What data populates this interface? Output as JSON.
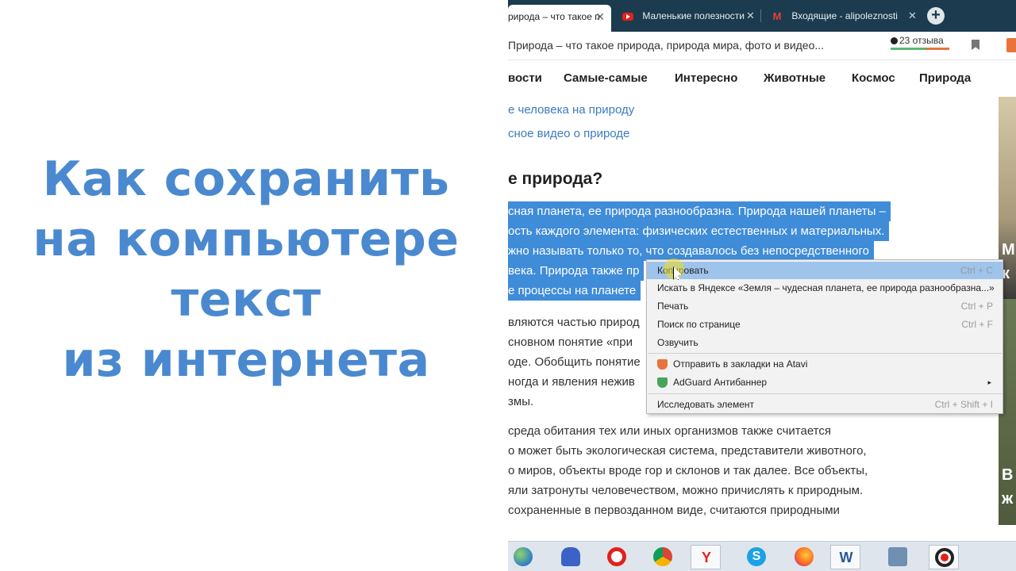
{
  "title": {
    "lines": [
      "Как сохранить",
      "на компьютере",
      "текст",
      "из интернета"
    ]
  },
  "tabs": [
    {
      "label": "рирода – что такое п",
      "close": "✕",
      "active": true
    },
    {
      "label": "Маленькие полезности",
      "close": "✕",
      "active": false
    },
    {
      "label": "Входящие - alipoleznosti",
      "close": "✕",
      "active": false
    }
  ],
  "newtab_symbol": "+",
  "addressbar": {
    "page_title": "Природа – что такое природа, природа мира, фото и видео...",
    "reviews": "23 отзыва"
  },
  "site_nav": [
    "вости",
    "Самые-самые",
    "Интересно",
    "Животные",
    "Космос",
    "Природа"
  ],
  "content": {
    "links": [
      "е человека на природу",
      "сное видео о природе"
    ],
    "section_heading": "е природа?",
    "selected_lines": [
      "сная планета, ее природа разнообразна. Природа нашей планеты –",
      "ость каждого элемента: физических естественных и материальных.",
      "жно называть только то, что создавалось без непосредственного",
      "века. Природа также пр",
      "е процессы на планете"
    ],
    "body_lines_a": [
      "вляются частью природ",
      "сновном понятие «при",
      "оде. Обобщить понятие",
      "ногда и явления нежив",
      "змы."
    ],
    "body_lines_b": [
      "среда обитания тех или иных организмов также считается",
      "о может быть экологическая система, представители животного,",
      "о миров, объекты вроде гор и склонов и так далее. Все объекты,",
      "яли затронуты человечеством, можно причислять к природным.",
      "сохраненные в первозданном виде, считаются природными"
    ]
  },
  "right_column_letters": [
    "М",
    "к",
    "В",
    "ж"
  ],
  "context_menu": {
    "items": [
      {
        "label": "Копировать",
        "shortcut": "Ctrl + C",
        "highlighted": true
      },
      {
        "label": "Искать в Яндексе «Земля – чудесная планета, ее природа разнообразна...»",
        "shortcut": ""
      },
      {
        "label": "Печать",
        "shortcut": "Ctrl + P"
      },
      {
        "label": "Поиск по странице",
        "shortcut": "Ctrl + F"
      },
      {
        "label": "Озвучить",
        "shortcut": ""
      },
      {
        "label": "Отправить в закладки на Atavi",
        "shortcut": ""
      },
      {
        "label": "AdGuard Антибаннер",
        "shortcut": "▸"
      },
      {
        "label": "Исследовать элемент",
        "shortcut": "Ctrl + Shift + I"
      }
    ]
  },
  "taskbar": {
    "yandex_letter": "Y",
    "skype_letter": "S",
    "word_letter": "W",
    "opera_letter": "O"
  },
  "colors": {
    "title_blue": "#4a89cf",
    "selection_blue": "#3f8cd9",
    "tabstrip": "#1d3b4f",
    "menu_highlight": "#9fc4ec"
  }
}
